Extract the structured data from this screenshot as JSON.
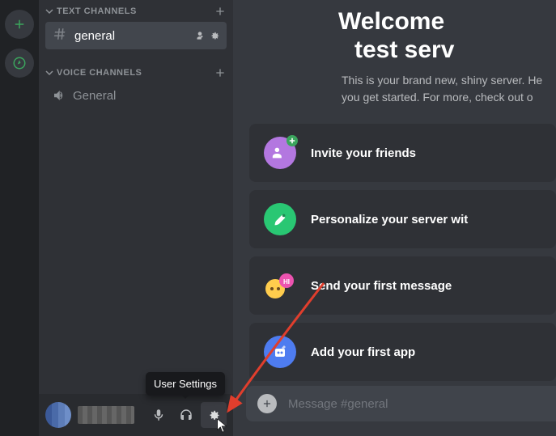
{
  "sections": {
    "text": {
      "label": "TEXT CHANNELS"
    },
    "voice": {
      "label": "VOICE CHANNELS"
    }
  },
  "channels": {
    "general": {
      "name": "general"
    },
    "voice_general": {
      "name": "General"
    }
  },
  "tooltip": {
    "user_settings": "User Settings"
  },
  "welcome": {
    "title_line1": "Welcome",
    "title_line2": "test serv",
    "subtitle_line1": "This is your brand new, shiny server. He",
    "subtitle_line2": "you get started. For more, check out o"
  },
  "cards": {
    "invite": "Invite your friends",
    "personalize": "Personalize your server wit",
    "first_message": "Send your first message",
    "first_app": "Add your first app"
  },
  "composer": {
    "placeholder": "Message #general"
  }
}
